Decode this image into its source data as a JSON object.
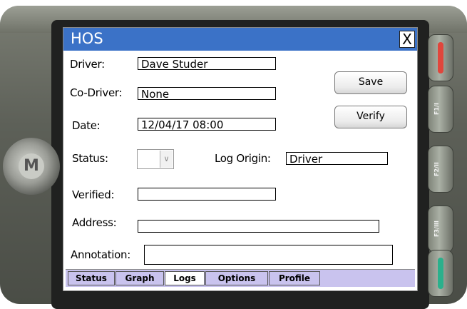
{
  "window": {
    "title": "HOS",
    "close_glyph": "X"
  },
  "form": {
    "driver_label": "Driver:",
    "driver_value": "Dave Studer",
    "codriver_label": "Co-Driver:",
    "codriver_value": "None",
    "date_label": "Date:",
    "date_value": "12/04/17  08:00",
    "status_label": "Status:",
    "status_value": "",
    "log_origin_label": "Log Origin:",
    "log_origin_value": "Driver",
    "verified_label": "Verified:",
    "verified_value": "",
    "address_label": "Address:",
    "address_value": "",
    "annotation_label": "Annotation:",
    "annotation_value": ""
  },
  "buttons": {
    "save": "Save",
    "verify": "Verify"
  },
  "tabs": [
    {
      "label": "Status",
      "active": false
    },
    {
      "label": "Graph",
      "active": false
    },
    {
      "label": "Logs",
      "active": true
    },
    {
      "label": "Options",
      "active": false
    },
    {
      "label": "Profile",
      "active": false
    }
  ],
  "device": {
    "side_keys": [
      {
        "name": "red-key-icon",
        "color": "#e0463c"
      },
      {
        "name": "f1-key",
        "label": "F1/I"
      },
      {
        "name": "f2-key",
        "label": "F2/II"
      },
      {
        "name": "f3-key",
        "label": "F3/III"
      },
      {
        "name": "green-key-icon",
        "color": "#2bb08c"
      }
    ]
  },
  "colors": {
    "titlebar": "#3b72c7",
    "tabbar": "#c9c3ee"
  }
}
